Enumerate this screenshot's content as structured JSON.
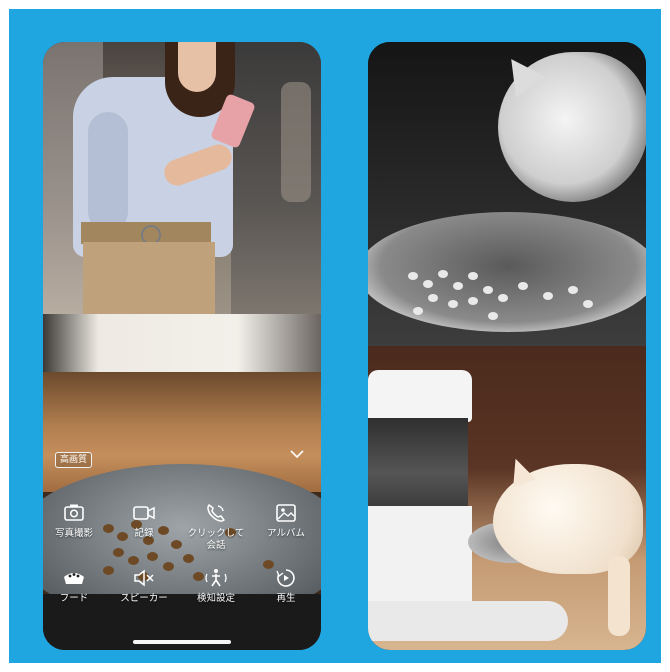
{
  "colors": {
    "background": "#1fa6e0",
    "overlay_text": "#ffffff"
  },
  "left_screen": {
    "quality_badge": "高画質",
    "collapse_icon": "chevron-down-icon",
    "controls_row1": [
      {
        "label": "写真撮影",
        "icon": "camera-icon"
      },
      {
        "label": "記録",
        "icon": "video-record-icon"
      },
      {
        "label": "クリックして\n会話",
        "icon": "phone-call-icon"
      },
      {
        "label": "アルバム",
        "icon": "album-icon"
      }
    ],
    "controls_row2": [
      {
        "label": "フード",
        "icon": "food-bowl-icon"
      },
      {
        "label": "スピーカー",
        "icon": "speaker-mute-icon"
      },
      {
        "label": "検知設定",
        "icon": "motion-detect-icon"
      },
      {
        "label": "再生",
        "icon": "replay-icon"
      }
    ]
  },
  "right_screen": {
    "top_image": "cat-eating-night-vision",
    "bottom_image": "kitten-at-feeder"
  }
}
